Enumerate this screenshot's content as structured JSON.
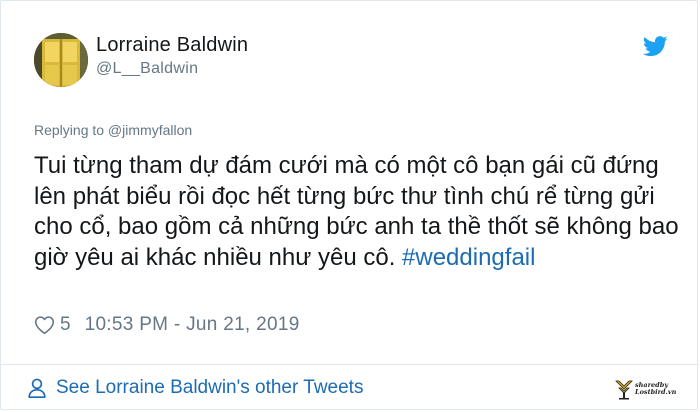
{
  "author": {
    "display_name": "Lorraine Baldwin",
    "handle": "@L__Baldwin"
  },
  "reply": {
    "text": "Replying to @jimmyfallon"
  },
  "tweet": {
    "text": "Tui từng tham dự đám cưới mà có một cô bạn gái cũ đứng lên phát biểu rồi đọc hết từng bức thư tình chú rể từng gửi cho cổ, bao gồm cả những bức anh ta thề thốt sẽ không bao giờ yêu ai khác nhiều như yêu cô.",
    "hashtag": "#weddingfail"
  },
  "meta": {
    "like_count": "5",
    "timestamp": "10:53 PM - Jun 21, 2019"
  },
  "footer": {
    "link_text": "See Lorraine Baldwin's other Tweets"
  },
  "watermark": {
    "line1": "sharedby",
    "line2": "Lostbird.vn"
  },
  "icons": {
    "brand": "twitter-bird-icon",
    "like": "heart-outline-icon",
    "profile": "person-outline-icon"
  },
  "colors": {
    "link_blue": "#1b6bb5",
    "twitter_blue": "#1da1f2",
    "muted_gray": "#657786",
    "text": "#14171a",
    "border": "#e1e8ed"
  }
}
